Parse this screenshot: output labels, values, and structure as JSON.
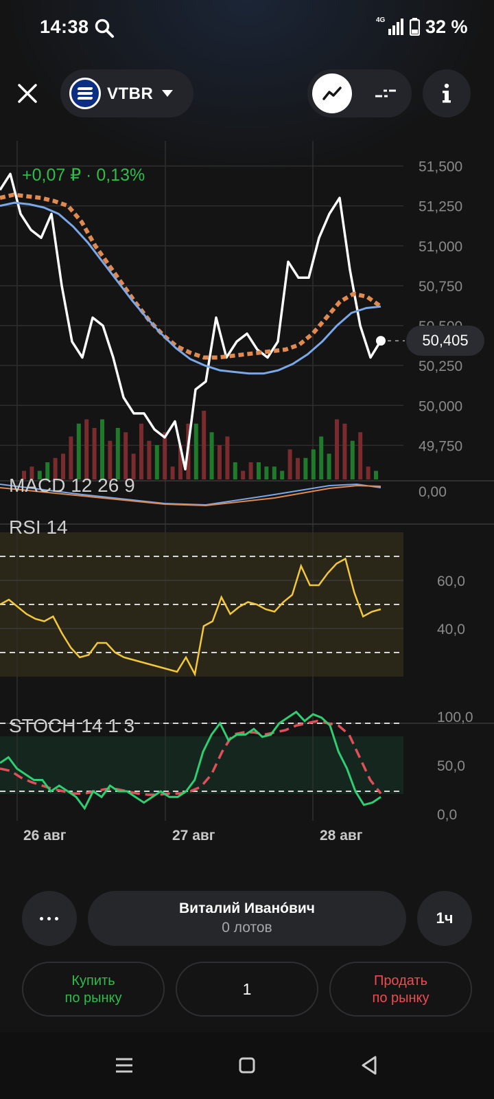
{
  "status_bar": {
    "time": "14:38",
    "network": "4G",
    "battery_percent": "32 %"
  },
  "header": {
    "ticker": "VTBR",
    "mode_line": "line-chart-icon",
    "mode_candles": "candles-icon",
    "info": "i"
  },
  "quote": {
    "change": "+0,07 ₽ · 0,13%",
    "last_price": "50,405"
  },
  "chart_data": {
    "type": "line",
    "price_axis": {
      "ticks": [
        "51,500",
        "51,250",
        "51,000",
        "50,750",
        "50,500",
        "50,250",
        "50,000",
        "49,750"
      ],
      "ylim": [
        49.7,
        51.55
      ]
    },
    "x_labels": [
      "26 авг",
      "27 авг",
      "28 авг"
    ],
    "series": [
      {
        "values": [
          51.35,
          51.45,
          51.2,
          51.1,
          51.05,
          51.2,
          50.75,
          50.4,
          50.3,
          50.55,
          50.5,
          50.3,
          50.05,
          49.95,
          49.95,
          49.85,
          49.8,
          49.9,
          49.6,
          50.1,
          50.15,
          50.55,
          50.3,
          50.4,
          50.45,
          50.35,
          50.3,
          50.4,
          50.9,
          50.8,
          50.8,
          51.05,
          51.2,
          51.3,
          50.85,
          50.5,
          50.3,
          50.405
        ],
        "color": "#ffffff"
      },
      {
        "values": [
          51.3,
          51.32,
          51.31,
          51.3,
          51.28,
          51.25,
          51.15,
          51.0,
          50.88,
          50.76,
          50.64,
          50.53,
          50.44,
          50.37,
          50.33,
          50.3,
          50.3,
          50.31,
          50.32,
          50.33,
          50.34,
          50.35,
          50.38,
          50.45,
          50.55,
          50.65,
          50.7,
          50.68,
          50.62
        ],
        "color": "#e08a52"
      },
      {
        "values": [
          51.25,
          51.27,
          51.26,
          51.24,
          51.2,
          51.12,
          51.02,
          50.9,
          50.78,
          50.66,
          50.55,
          50.45,
          50.36,
          50.29,
          50.25,
          50.22,
          50.21,
          50.2,
          50.2,
          50.22,
          50.26,
          50.32,
          50.4,
          50.5,
          50.58,
          50.61,
          50.62
        ],
        "color": "#7ba8e8"
      }
    ],
    "volume": [
      2,
      3,
      2,
      4,
      5,
      6,
      10,
      13,
      14,
      12,
      14,
      9,
      12,
      11,
      6,
      13,
      9,
      8,
      11,
      3,
      8,
      13,
      13,
      16,
      11,
      8,
      10,
      4,
      2,
      4,
      4,
      3,
      3,
      2,
      7,
      5,
      5,
      7,
      10,
      6,
      14,
      13,
      9,
      11,
      3,
      2
    ]
  },
  "indicators": {
    "macd": {
      "label": "MACD 12 26 9",
      "tick": "0,00"
    },
    "rsi": {
      "label": "RSI 14",
      "ticks": [
        "60,0",
        "40,0"
      ],
      "values": [
        50,
        52,
        49,
        46,
        44,
        43,
        45,
        38,
        32,
        28,
        29,
        34,
        34,
        30,
        28,
        27,
        26,
        25,
        24,
        23,
        22,
        28,
        21,
        41,
        43,
        53,
        46,
        49,
        51,
        50,
        48,
        47,
        51,
        54,
        66,
        58,
        58,
        63,
        67,
        69,
        55,
        45,
        47,
        48
      ]
    },
    "stoch": {
      "label": "STOCH 14 1 3",
      "ticks": [
        "100,0",
        "50,0",
        "0,0"
      ],
      "k": [
        45,
        50,
        40,
        35,
        30,
        30,
        20,
        25,
        20,
        15,
        5,
        20,
        15,
        25,
        20,
        20,
        15,
        10,
        15,
        20,
        15,
        15,
        20,
        30,
        55,
        70,
        80,
        65,
        70,
        70,
        75,
        68,
        70,
        80,
        85,
        90,
        82,
        88,
        85,
        78,
        55,
        40,
        20,
        8,
        10,
        15
      ],
      "d": [
        40,
        38,
        32,
        28,
        25,
        22,
        20,
        18,
        18,
        20,
        22,
        22,
        20,
        18,
        17,
        17,
        18,
        18,
        20,
        24,
        35,
        55,
        70,
        72,
        72,
        70,
        72,
        74,
        78,
        80,
        82,
        80,
        78,
        70,
        50,
        30,
        18
      ]
    }
  },
  "trade_panel": {
    "account_name": "Виталий Иванóвич",
    "lots": "0 лотов",
    "interval": "1ч",
    "buy_line1": "Купить",
    "buy_line2": "по рынку",
    "quantity": "1",
    "sell_line1": "Продать",
    "sell_line2": "по рынку"
  },
  "nav": {
    "recents": "recents-icon",
    "home": "home-icon",
    "back": "back-icon"
  }
}
